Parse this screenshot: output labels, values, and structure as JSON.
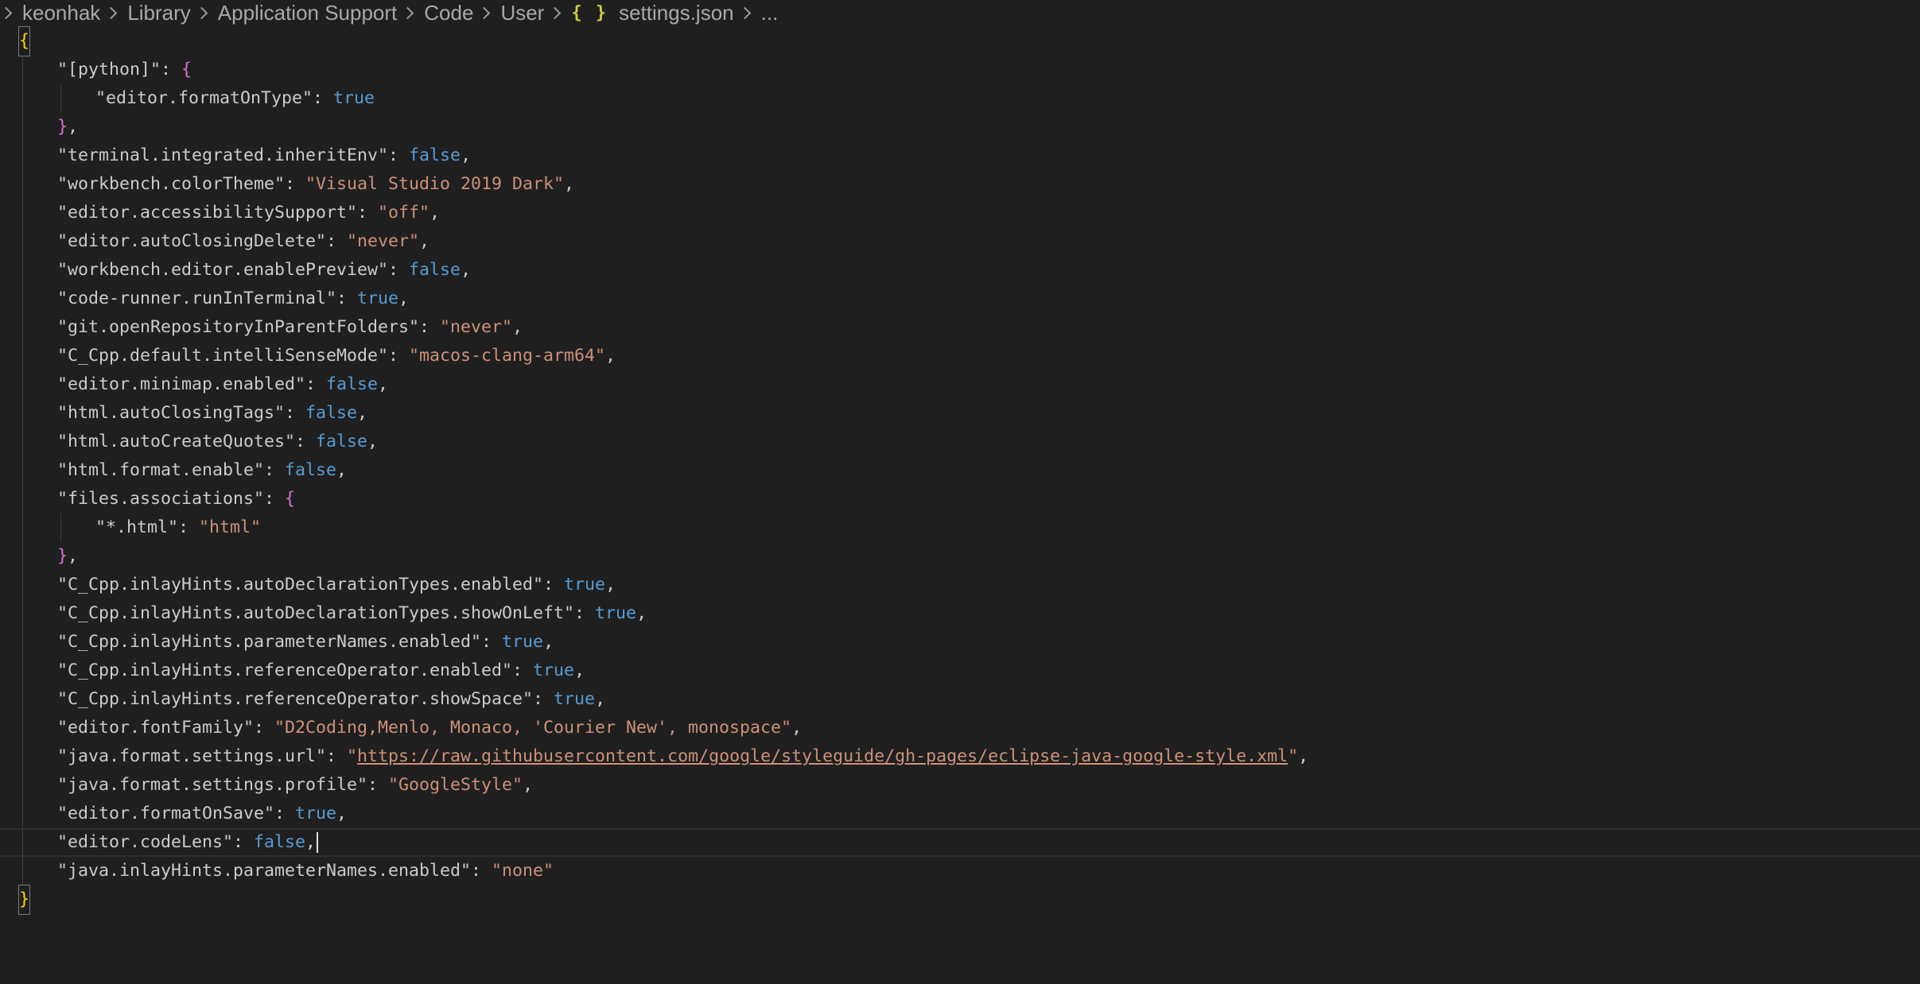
{
  "breadcrumb": {
    "items": [
      "keonhak",
      "Library",
      "Application Support",
      "Code",
      "User",
      "settings.json",
      "..."
    ],
    "json_icon": "{ }"
  },
  "editor": {
    "open_brace": "{",
    "close_brace": "}",
    "lines": [
      {
        "indent": 1,
        "key": "\"[python]\"",
        "colon": ": ",
        "open": "{"
      },
      {
        "indent": 2,
        "key": "\"editor.formatOnType\"",
        "colon": ": ",
        "bool": "true"
      },
      {
        "indent": 1,
        "close": "}",
        "comma": ","
      },
      {
        "indent": 1,
        "key": "\"terminal.integrated.inheritEnv\"",
        "colon": ": ",
        "bool": "false",
        "comma": ","
      },
      {
        "indent": 1,
        "key": "\"workbench.colorTheme\"",
        "colon": ": ",
        "str": "\"Visual Studio 2019 Dark\"",
        "comma": ","
      },
      {
        "indent": 1,
        "key": "\"editor.accessibilitySupport\"",
        "colon": ": ",
        "str": "\"off\"",
        "comma": ","
      },
      {
        "indent": 1,
        "key": "\"editor.autoClosingDelete\"",
        "colon": ": ",
        "str": "\"never\"",
        "comma": ","
      },
      {
        "indent": 1,
        "key": "\"workbench.editor.enablePreview\"",
        "colon": ": ",
        "bool": "false",
        "comma": ","
      },
      {
        "indent": 1,
        "key": "\"code-runner.runInTerminal\"",
        "colon": ": ",
        "bool": "true",
        "comma": ","
      },
      {
        "indent": 1,
        "key": "\"git.openRepositoryInParentFolders\"",
        "colon": ": ",
        "str": "\"never\"",
        "comma": ","
      },
      {
        "indent": 1,
        "key": "\"C_Cpp.default.intelliSenseMode\"",
        "colon": ": ",
        "str": "\"macos-clang-arm64\"",
        "comma": ","
      },
      {
        "indent": 1,
        "key": "\"editor.minimap.enabled\"",
        "colon": ": ",
        "bool": "false",
        "comma": ","
      },
      {
        "indent": 1,
        "key": "\"html.autoClosingTags\"",
        "colon": ": ",
        "bool": "false",
        "comma": ","
      },
      {
        "indent": 1,
        "key": "\"html.autoCreateQuotes\"",
        "colon": ": ",
        "bool": "false",
        "comma": ","
      },
      {
        "indent": 1,
        "key": "\"html.format.enable\"",
        "colon": ": ",
        "bool": "false",
        "comma": ","
      },
      {
        "indent": 1,
        "key": "\"files.associations\"",
        "colon": ": ",
        "open": "{"
      },
      {
        "indent": 2,
        "key": "\"*.html\"",
        "colon": ": ",
        "str": "\"html\""
      },
      {
        "indent": 1,
        "close": "}",
        "comma": ","
      },
      {
        "indent": 1,
        "key": "\"C_Cpp.inlayHints.autoDeclarationTypes.enabled\"",
        "colon": ": ",
        "bool": "true",
        "comma": ","
      },
      {
        "indent": 1,
        "key": "\"C_Cpp.inlayHints.autoDeclarationTypes.showOnLeft\"",
        "colon": ": ",
        "bool": "true",
        "comma": ","
      },
      {
        "indent": 1,
        "key": "\"C_Cpp.inlayHints.parameterNames.enabled\"",
        "colon": ": ",
        "bool": "true",
        "comma": ","
      },
      {
        "indent": 1,
        "key": "\"C_Cpp.inlayHints.referenceOperator.enabled\"",
        "colon": ": ",
        "bool": "true",
        "comma": ","
      },
      {
        "indent": 1,
        "key": "\"C_Cpp.inlayHints.referenceOperator.showSpace\"",
        "colon": ": ",
        "bool": "true",
        "comma": ","
      },
      {
        "indent": 1,
        "key": "\"editor.fontFamily\"",
        "colon": ": ",
        "str": "\"D2Coding,Menlo, Monaco, 'Courier New', monospace\"",
        "comma": ","
      },
      {
        "indent": 1,
        "key": "\"java.format.settings.url\"",
        "colon": ": ",
        "url": "https://raw.githubusercontent.com/google/styleguide/gh-pages/eclipse-java-google-style.xml",
        "comma": ","
      },
      {
        "indent": 1,
        "key": "\"java.format.settings.profile\"",
        "colon": ": ",
        "str": "\"GoogleStyle\"",
        "comma": ","
      },
      {
        "indent": 1,
        "key": "\"editor.formatOnSave\"",
        "colon": ": ",
        "bool": "true",
        "comma": ","
      },
      {
        "indent": 1,
        "key": "\"editor.codeLens\"",
        "colon": ": ",
        "bool": "false",
        "comma": ",",
        "cursor": true
      },
      {
        "indent": 1,
        "key": "\"java.inlayHints.parameterNames.enabled\"",
        "colon": ": ",
        "str": "\"none\""
      }
    ]
  }
}
